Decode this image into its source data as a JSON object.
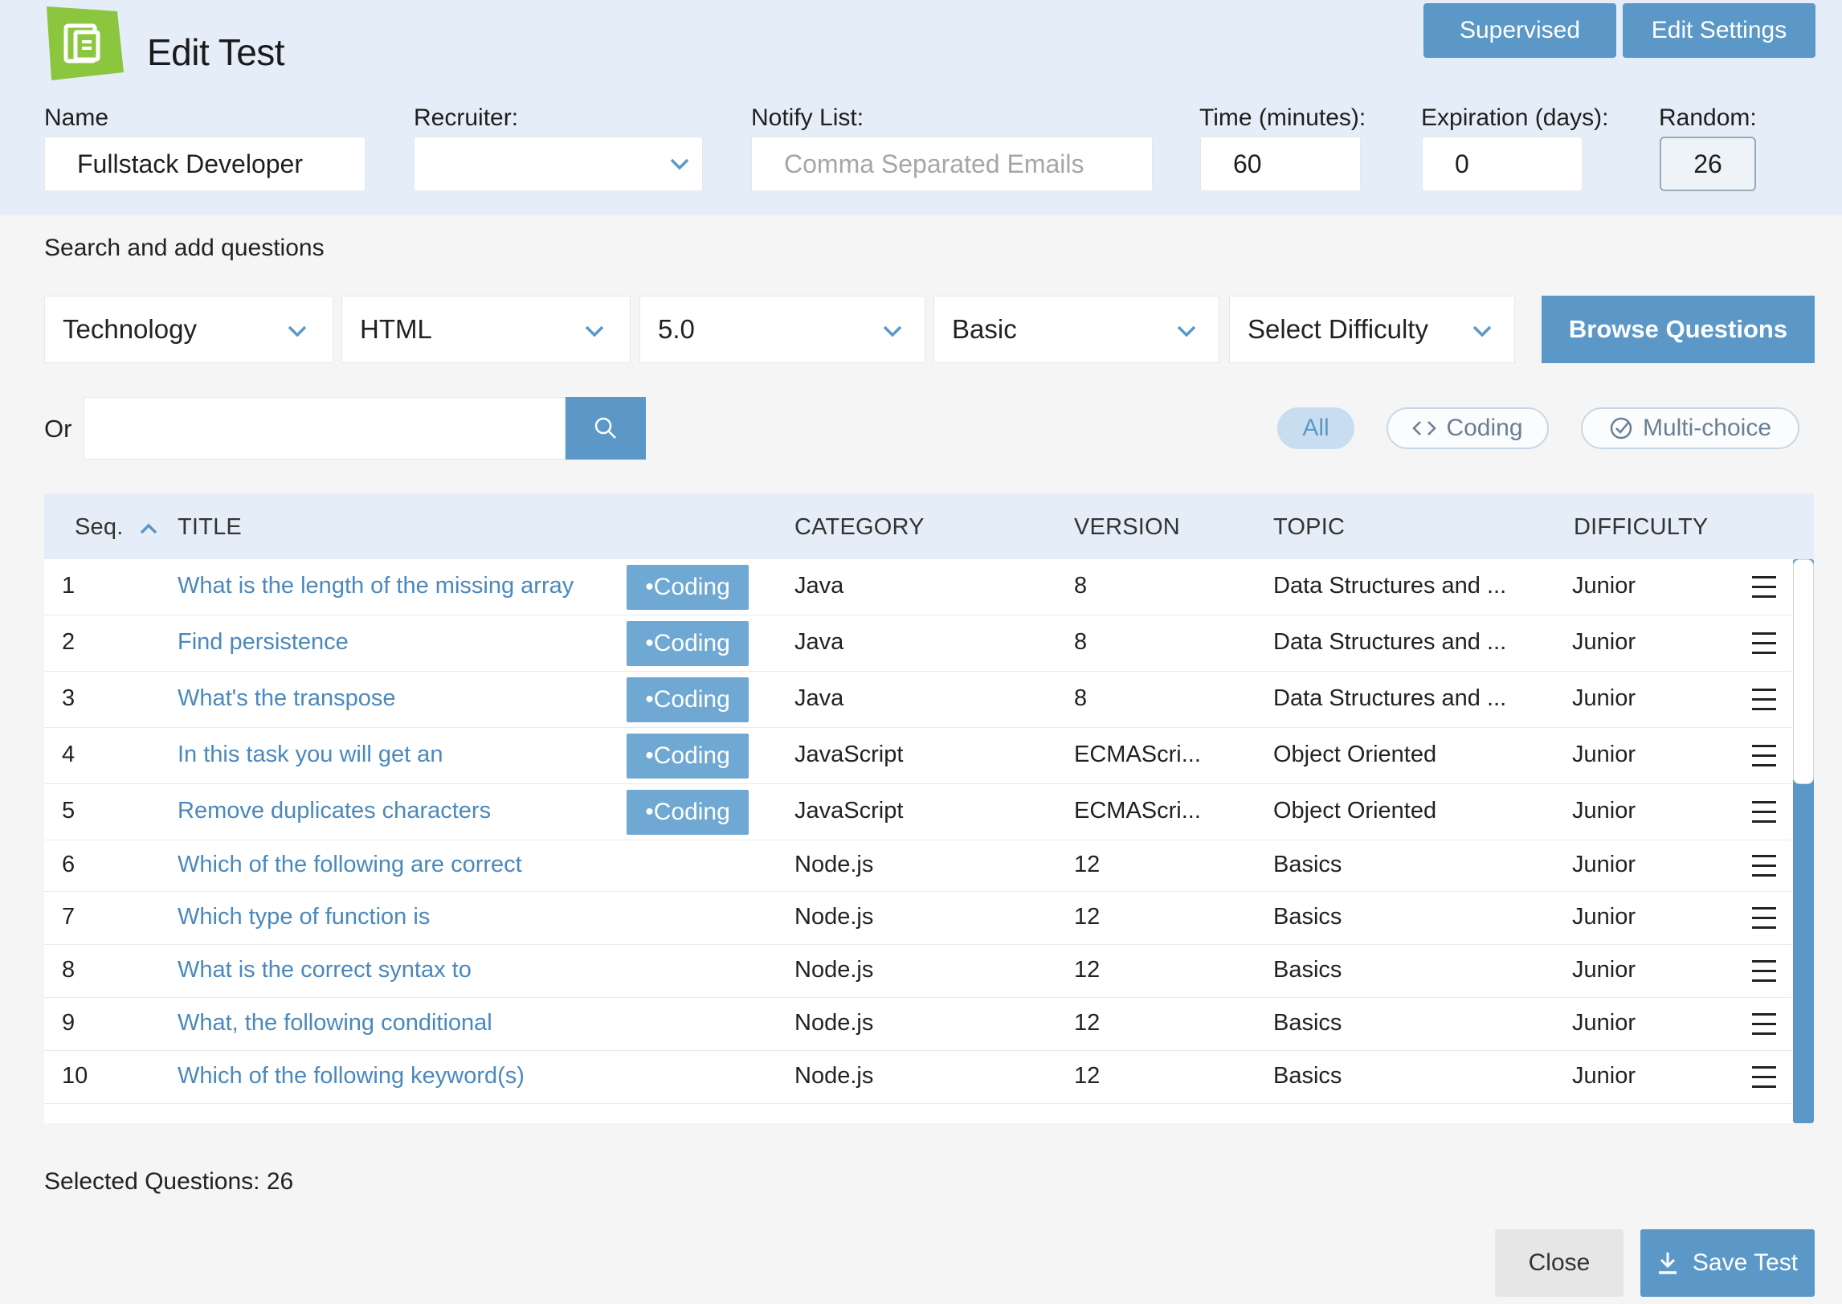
{
  "header": {
    "title": "Edit Test",
    "supervised_label": "Supervised",
    "edit_settings_label": "Edit Settings"
  },
  "fields": {
    "name_label": "Name",
    "name_value": "Fullstack Developer",
    "recruiter_label": "Recruiter:",
    "recruiter_value": "",
    "notify_label": "Notify List:",
    "notify_placeholder": "Comma Separated Emails",
    "time_label": "Time (minutes):",
    "time_value": "60",
    "expiration_label": "Expiration (days):",
    "expiration_value": "0",
    "random_label": "Random:",
    "random_value": "26"
  },
  "search": {
    "section_label": "Search and add questions",
    "filters": [
      "Technology",
      "HTML",
      "5.0",
      "Basic",
      "Select Difficulty"
    ],
    "browse_label": "Browse Questions",
    "or_label": "Or",
    "pills": {
      "all": "All",
      "coding": "Coding",
      "multichoice": "Multi-choice"
    }
  },
  "table": {
    "headers": {
      "seq": "Seq.",
      "title": "TITLE",
      "category": "CATEGORY",
      "version": "VERSION",
      "topic": "TOPIC",
      "difficulty": "DIFFICULTY"
    },
    "rows": [
      {
        "seq": "1",
        "title": "What is the length of the missing array",
        "badge": "Coding",
        "category": "Java",
        "version": "8",
        "topic": "Data Structures and ...",
        "difficulty": "Junior"
      },
      {
        "seq": "2",
        "title": "Find persistence",
        "badge": "Coding",
        "category": "Java",
        "version": "8",
        "topic": "Data Structures and ...",
        "difficulty": "Junior"
      },
      {
        "seq": "3",
        "title": "What's the transpose",
        "badge": "Coding",
        "category": "Java",
        "version": "8",
        "topic": "Data Structures and ...",
        "difficulty": "Junior"
      },
      {
        "seq": "4",
        "title": "In this task you will get an",
        "badge": "Coding",
        "category": "JavaScript",
        "version": "ECMAScri...",
        "topic": "Object Oriented",
        "difficulty": "Junior"
      },
      {
        "seq": "5",
        "title": "Remove duplicates characters",
        "badge": "Coding",
        "category": "JavaScript",
        "version": "ECMAScri...",
        "topic": "Object Oriented",
        "difficulty": "Junior"
      },
      {
        "seq": "6",
        "title": "Which of the following are correct",
        "badge": "",
        "category": "Node.js",
        "version": "12",
        "topic": "Basics",
        "difficulty": "Junior"
      },
      {
        "seq": "7",
        "title": "Which type of function is",
        "badge": "",
        "category": "Node.js",
        "version": "12",
        "topic": "Basics",
        "difficulty": "Junior"
      },
      {
        "seq": "8",
        "title": "What is the correct syntax to",
        "badge": "",
        "category": "Node.js",
        "version": "12",
        "topic": "Basics",
        "difficulty": "Junior"
      },
      {
        "seq": "9",
        "title": "What, the following conditional",
        "badge": "",
        "category": "Node.js",
        "version": "12",
        "topic": "Basics",
        "difficulty": "Junior"
      },
      {
        "seq": "10",
        "title": "Which of the following keyword(s)",
        "badge": "",
        "category": "Node.js",
        "version": "12",
        "topic": "Basics",
        "difficulty": "Junior"
      }
    ]
  },
  "footer": {
    "selected_label": "Selected Questions: 26",
    "close_label": "Close",
    "save_label": "Save Test"
  },
  "colors": {
    "accent": "#5b98c7",
    "header_bg": "#e5eef8",
    "logo_green": "#8cc63f",
    "link": "#4a88bd"
  },
  "icons": {
    "logo": "document-stack-icon",
    "search": "search-icon",
    "coding": "code-icon",
    "multichoice": "check-circle-icon",
    "sort": "chevron-up-icon",
    "row_menu": "hamburger-icon",
    "save": "download-icon",
    "dropdown": "chevron-down-icon"
  }
}
